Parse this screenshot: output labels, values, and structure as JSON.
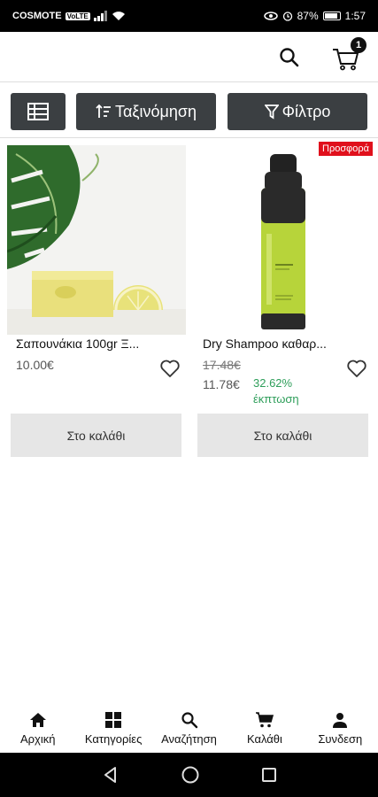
{
  "status_bar": {
    "carrier": "COSMOTE",
    "volte": "VoLTE",
    "battery": "87%",
    "time": "1:57"
  },
  "header": {
    "cart_count": "1"
  },
  "toolbar": {
    "sort_label": "Ταξινόμηση",
    "filter_label": "Φίλτρο"
  },
  "products": [
    {
      "title": "Σαπουνάκια 100gr Ξ...",
      "price": "10.00€",
      "button": "Στο καλάθι"
    },
    {
      "badge": "Προσφορά",
      "title": "Dry Shampoo καθαρ...",
      "old_price": "17.48€",
      "price": "11.78€",
      "discount_value": "32.62%",
      "discount_word": "έκπτωση",
      "button": "Στο καλάθι"
    }
  ],
  "bottom_nav": [
    {
      "label": "Αρχική",
      "icon": "home-icon"
    },
    {
      "label": "Κατηγορίες",
      "icon": "grid-icon"
    },
    {
      "label": "Αναζήτηση",
      "icon": "search-icon"
    },
    {
      "label": "Καλάθι",
      "icon": "cart-icon"
    },
    {
      "label": "Συνδεση",
      "icon": "user-icon"
    }
  ],
  "colors": {
    "toolbar_button": "#3b3f42",
    "offer_badge": "#e0101c",
    "discount_text": "#2e9e5a",
    "add_to_cart_bg": "#e6e6e6"
  }
}
